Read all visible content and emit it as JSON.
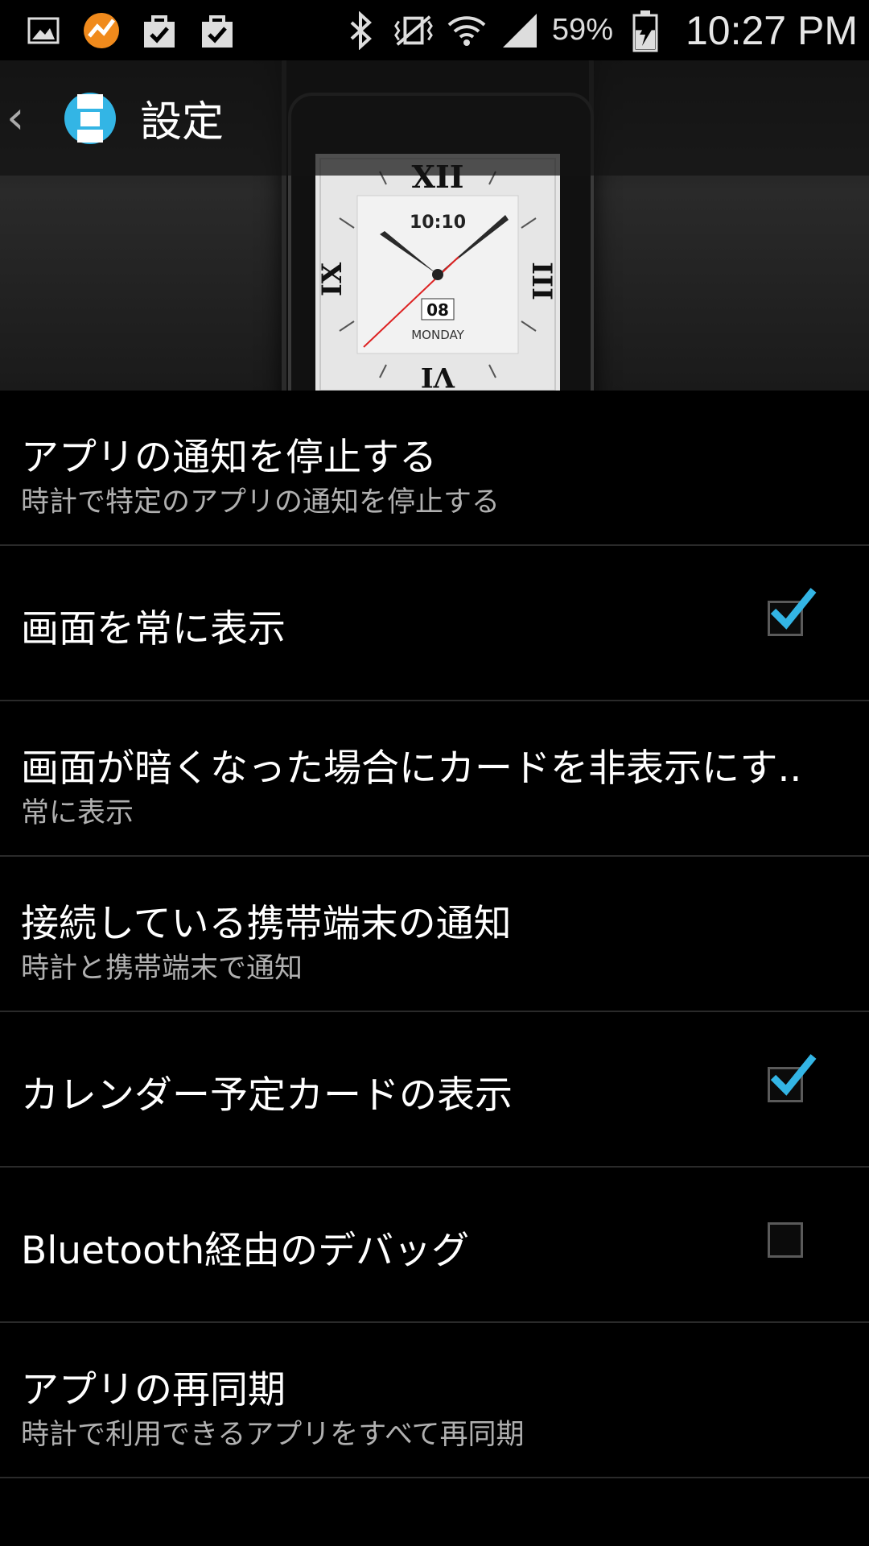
{
  "status_bar": {
    "left_icons": [
      "gallery-icon",
      "app-chart-icon",
      "shopping-bag-check-icon",
      "shopping-bag-check-icon"
    ],
    "right_icons": [
      "bluetooth-icon",
      "vibrate-mute-icon",
      "wifi-icon",
      "signal-icon"
    ],
    "battery_percent": "59%",
    "battery_level": 0.59,
    "time": "10:27 PM"
  },
  "action_bar": {
    "back_icon": "chevron-left-icon",
    "app_icon": "android-wear-icon",
    "title": "設定"
  },
  "watch_preview": {
    "time_text": "10:10",
    "date_text": "08",
    "day_text": "MONDAY",
    "numerals": {
      "top": "XII",
      "right": "III",
      "bottom": "VI",
      "left": "IX"
    }
  },
  "settings": [
    {
      "title": "アプリの通知を停止する",
      "subtitle": "時計で特定のアプリの通知を停止する"
    },
    {
      "title": "画面を常に表示",
      "checked": true
    },
    {
      "title": "画面が暗くなった場合にカードを非表示にす..",
      "subtitle": "常に表示"
    },
    {
      "title": "接続している携帯端末の通知",
      "subtitle": "時計と携帯端末で通知"
    },
    {
      "title": "カレンダー予定カードの表示",
      "checked": true
    },
    {
      "title": "Bluetooth経由のデバッグ",
      "checked": false
    },
    {
      "title": "アプリの再同期",
      "subtitle": "時計で利用できるアプリをすべて再同期"
    }
  ],
  "colors": {
    "accent": "#33b5e5",
    "background": "#000000",
    "divider": "#2a2a2a"
  }
}
